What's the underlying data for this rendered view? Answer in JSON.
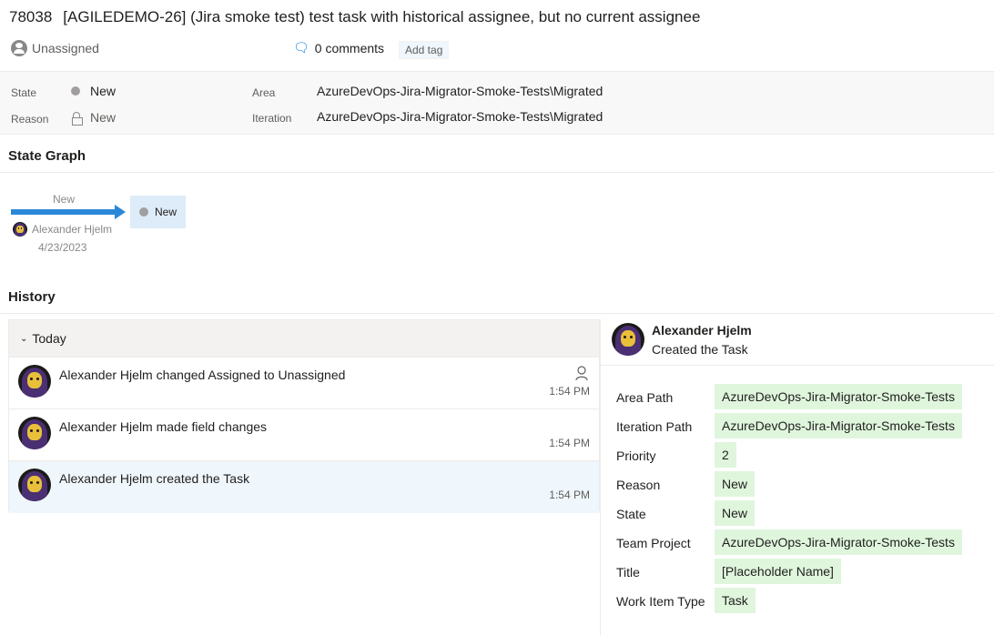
{
  "workitem": {
    "id": "78038",
    "title": "[AGILEDEMO-26] (Jira smoke test) test task with historical assignee, but no current assignee",
    "assignee": "Unassigned",
    "comments_label": "0 comments",
    "add_tag_label": "Add tag"
  },
  "fields": {
    "state_label": "State",
    "state_value": "New",
    "reason_label": "Reason",
    "reason_value": "New",
    "area_label": "Area",
    "area_value": "AzureDevOps-Jira-Migrator-Smoke-Tests\\Migrated",
    "iteration_label": "Iteration",
    "iteration_value": "AzureDevOps-Jira-Migrator-Smoke-Tests\\Migrated"
  },
  "state_graph": {
    "title": "State Graph",
    "transition_label": "New",
    "state_name": "New",
    "user": "Alexander Hjelm",
    "date": "4/23/2023",
    "arrow_color": "#2b88d8"
  },
  "history": {
    "title": "History",
    "group_label": "Today",
    "items": [
      {
        "text": "Alexander Hjelm changed Assigned to Unassigned",
        "time": "1:54 PM",
        "icon": "person-icon"
      },
      {
        "text": "Alexander Hjelm made field changes",
        "time": "1:54 PM"
      },
      {
        "text": "Alexander Hjelm created the Task",
        "time": "1:54 PM",
        "selected": true
      }
    ]
  },
  "detail": {
    "user": "Alexander Hjelm",
    "action": "Created the Task",
    "changes": [
      {
        "label": "Area Path",
        "value": "AzureDevOps-Jira-Migrator-Smoke-Tests"
      },
      {
        "label": "Iteration Path",
        "value": "AzureDevOps-Jira-Migrator-Smoke-Tests"
      },
      {
        "label": "Priority",
        "value": "2"
      },
      {
        "label": "Reason",
        "value": "New"
      },
      {
        "label": "State",
        "value": "New"
      },
      {
        "label": "Team Project",
        "value": "AzureDevOps-Jira-Migrator-Smoke-Tests"
      },
      {
        "label": "Title",
        "value": "[Placeholder Name]"
      },
      {
        "label": "Work Item Type",
        "value": "Task"
      }
    ]
  },
  "colors": {
    "accent": "#0078d4",
    "selected_row": "#eff6fc",
    "added_value_bg": "#dff6dd",
    "state_new": "#a19f9d"
  }
}
